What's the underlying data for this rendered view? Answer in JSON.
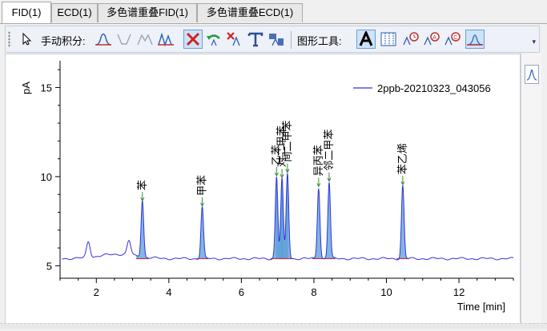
{
  "tabs": [
    {
      "label": "FID(1)",
      "active": true
    },
    {
      "label": "ECD(1)",
      "active": false
    },
    {
      "label": "多色谱重叠FID(1)",
      "active": false
    },
    {
      "label": "多色谱重叠ECD(1)",
      "active": false
    }
  ],
  "toolbar": {
    "manual_integration_label": "手动积分:",
    "graph_tools_label": "图形工具:"
  },
  "chart_data": {
    "type": "line",
    "ylabel": "pA",
    "xlabel": "Time [min]",
    "xlim": [
      1.0,
      13.5
    ],
    "ylim": [
      4.3,
      16.5
    ],
    "x_ticks": [
      "2",
      "4",
      "6",
      "8",
      "10",
      "12"
    ],
    "y_ticks": [
      "5",
      "10",
      "15"
    ],
    "legend": "2ppb-20210323_043056",
    "series_color": "#3333dd",
    "fill_color": "#5a9ed6",
    "baseline": 5.4,
    "peaks": [
      {
        "label": "苯",
        "rt": 3.27,
        "height": 8.6
      },
      {
        "label": "甲苯",
        "rt": 4.92,
        "height": 8.3
      },
      {
        "label": "乙苯",
        "rt": 6.97,
        "height": 10.0
      },
      {
        "label": "对二甲苯",
        "rt": 7.12,
        "height": 9.9
      },
      {
        "label": "间二甲苯",
        "rt": 7.27,
        "height": 10.2
      },
      {
        "label": "异丙苯",
        "rt": 8.13,
        "height": 9.4
      },
      {
        "label": "邻二甲苯",
        "rt": 8.42,
        "height": 9.7
      },
      {
        "label": "苯乙烯",
        "rt": 10.45,
        "height": 9.5
      }
    ],
    "unlabeled_bumps": [
      {
        "rt": 1.78,
        "height": 6.3
      },
      {
        "rt": 2.9,
        "height": 6.2
      }
    ]
  }
}
